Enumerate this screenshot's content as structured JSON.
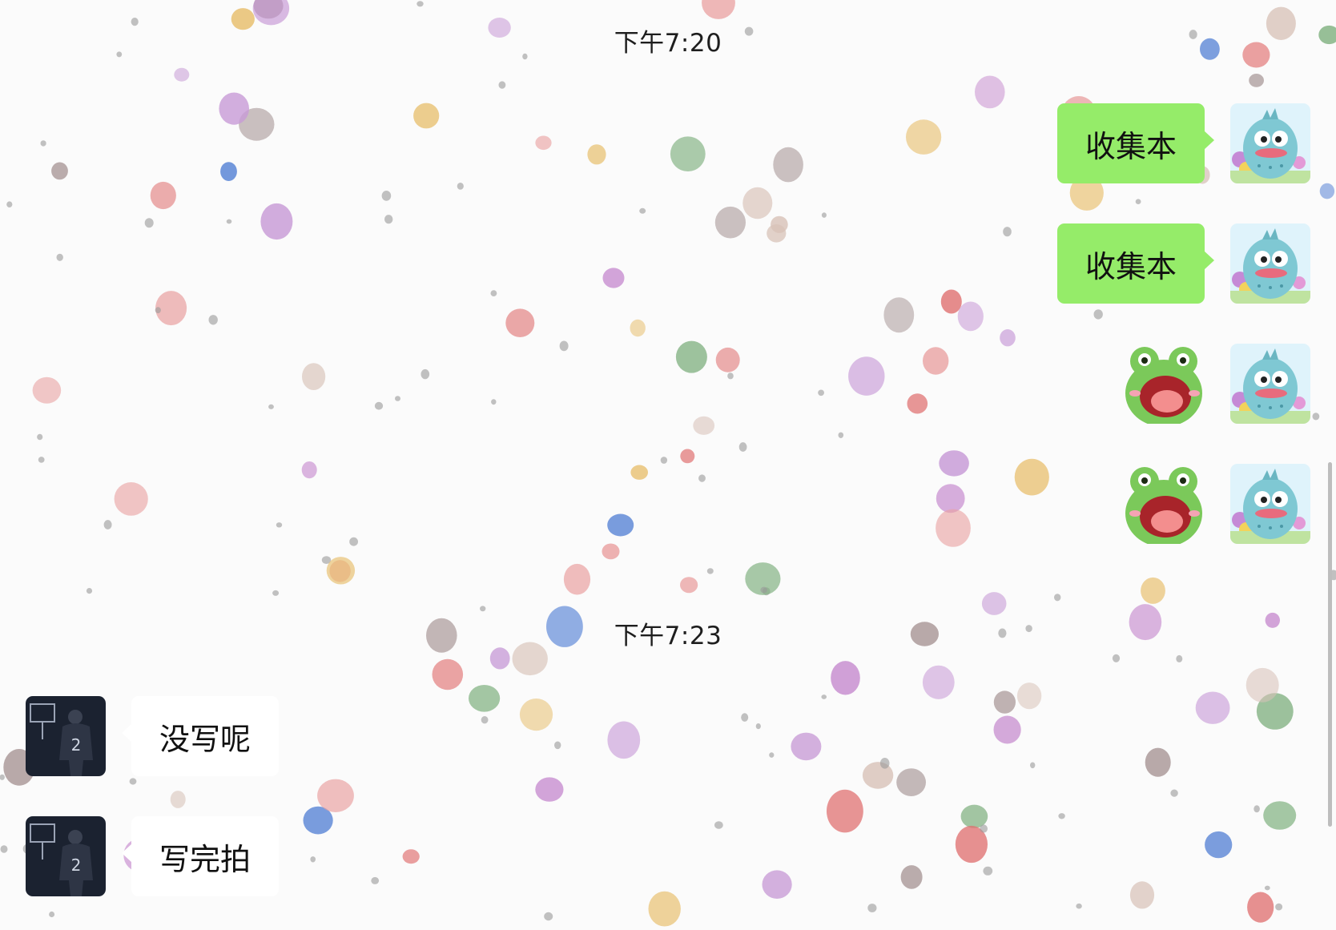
{
  "chat": {
    "messages": [
      {
        "type": "timestamp",
        "text": "下午7:20"
      },
      {
        "type": "text",
        "from": "self",
        "text": "收集本"
      },
      {
        "type": "text",
        "from": "self",
        "text": "收集本"
      },
      {
        "type": "sticker",
        "from": "self",
        "sticker": "frog-shouting-sticker"
      },
      {
        "type": "sticker",
        "from": "self",
        "sticker": "frog-shouting-sticker"
      },
      {
        "type": "timestamp",
        "text": "下午7:23"
      },
      {
        "type": "text",
        "from": "other",
        "text": "没写呢"
      },
      {
        "type": "text",
        "from": "other",
        "text": "写完拍"
      }
    ]
  },
  "avatars": {
    "self": "hangyodon-avatar",
    "other": "basketball-player-avatar"
  },
  "colors": {
    "outgoing_bubble": "#95ec69",
    "incoming_bubble": "#ffffff",
    "background": "#fbfbfb"
  }
}
